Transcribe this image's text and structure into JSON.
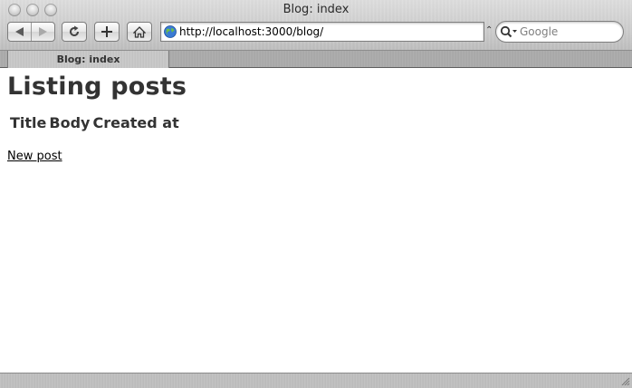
{
  "window": {
    "title": "Blog: index"
  },
  "toolbar": {
    "address": "http://localhost:3000/blog/",
    "search_placeholder": "Google",
    "snapback_glyph": "⌃"
  },
  "tabs": [
    {
      "label": "Blog: index",
      "active": true
    }
  ],
  "page": {
    "heading": "Listing posts",
    "table_headers": [
      "Title",
      "Body",
      "Created at"
    ],
    "new_post_link": "New post"
  },
  "colors": {
    "text": "#333333",
    "link": "#000000",
    "globe": "#3a7bd5"
  }
}
